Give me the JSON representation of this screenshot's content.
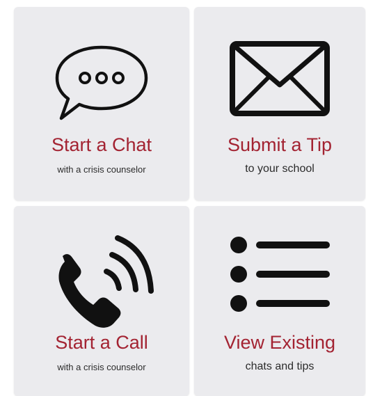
{
  "cards": [
    {
      "id": "chat",
      "icon": "speech-bubble-icon",
      "title": "Start a Chat",
      "subtitle": "with a crisis counselor"
    },
    {
      "id": "tip",
      "icon": "envelope-icon",
      "title": "Submit a Tip",
      "subtitle": "to your school"
    },
    {
      "id": "call",
      "icon": "phone-icon",
      "title": "Start a Call",
      "subtitle": "with a crisis counselor"
    },
    {
      "id": "view",
      "icon": "list-icon",
      "title": "View Existing",
      "subtitle": "chats and tips"
    }
  ],
  "colors": {
    "card_background": "#ebebee",
    "title": "#a32332",
    "subtitle": "#2b2b2b",
    "icon": "#111111"
  }
}
